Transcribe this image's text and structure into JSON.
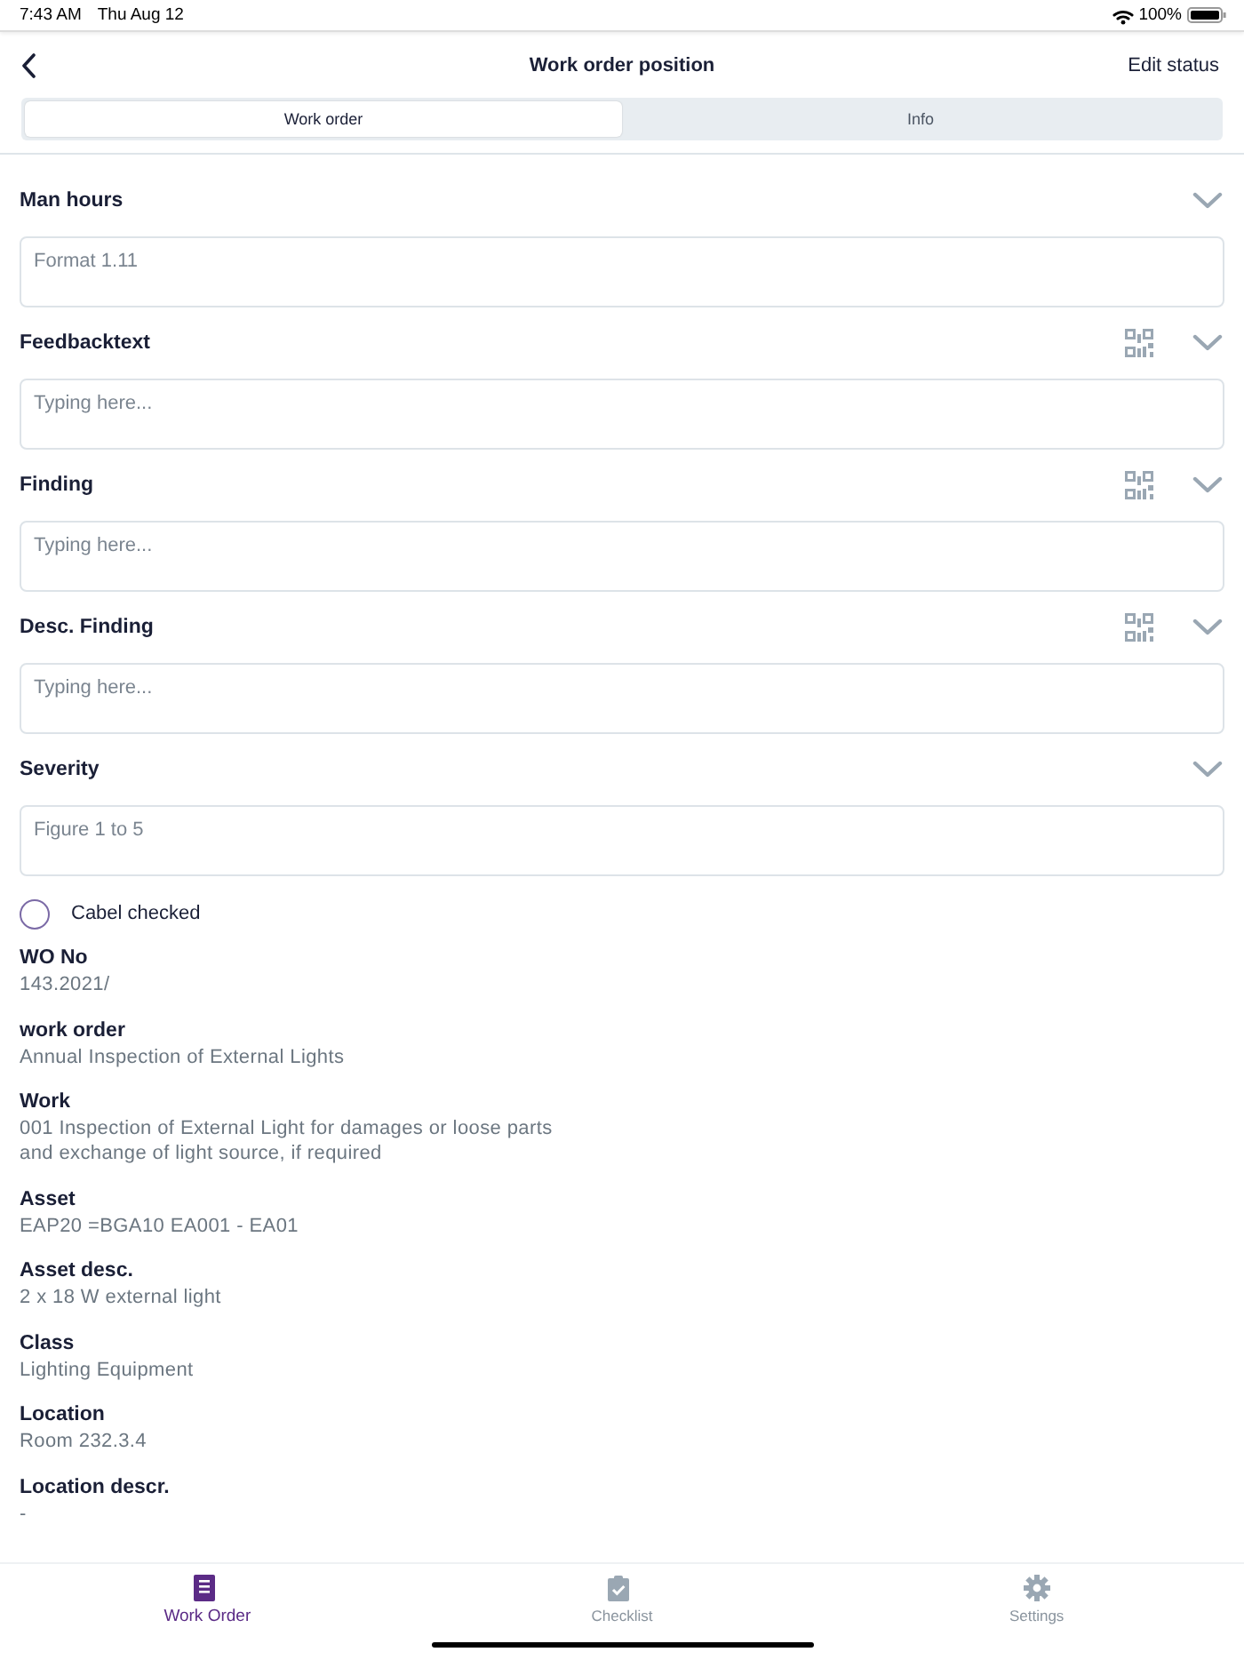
{
  "status_bar": {
    "time": "7:43 AM",
    "date": "Thu Aug 12",
    "battery": "100%"
  },
  "header": {
    "title": "Work order position",
    "action": "Edit status"
  },
  "tabs": [
    {
      "label": "Work order",
      "selected": true
    },
    {
      "label": "Info",
      "selected": false
    }
  ],
  "sections": [
    {
      "label": "Man hours",
      "placeholder": "Format 1.11",
      "scan": false
    },
    {
      "label": "Feedbacktext",
      "placeholder": "Typing here...",
      "scan": true
    },
    {
      "label": "Finding",
      "placeholder": "Typing here...",
      "scan": true
    },
    {
      "label": "Desc. Finding",
      "placeholder": "Typing here...",
      "scan": true
    },
    {
      "label": "Severity",
      "placeholder": "Figure 1 to 5",
      "scan": false
    }
  ],
  "checkbox": {
    "label": "Cabel checked",
    "checked": false
  },
  "details": [
    {
      "label": "WO No",
      "value": "143.2021/"
    },
    {
      "label": "work order",
      "value": "Annual Inspection of External Lights"
    },
    {
      "label": "Work",
      "value": "001 Inspection of External Light for damages or loose parts\nand exchange of light source, if required"
    },
    {
      "label": "Asset",
      "value": "EAP20 =BGA10 EA001 - EA01"
    },
    {
      "label": "Asset desc.",
      "value": "2 x 18 W external light"
    },
    {
      "label": "Class",
      "value": "Lighting Equipment"
    },
    {
      "label": "Location",
      "value": "Room 232.3.4"
    },
    {
      "label": "Location descr.",
      "value": "-"
    }
  ],
  "bottom_tabs": [
    {
      "label": "Work Order",
      "kind": "document",
      "selected": true
    },
    {
      "label": "Checklist",
      "kind": "checklist",
      "selected": false
    },
    {
      "label": "Settings",
      "kind": "gear",
      "selected": false
    }
  ]
}
